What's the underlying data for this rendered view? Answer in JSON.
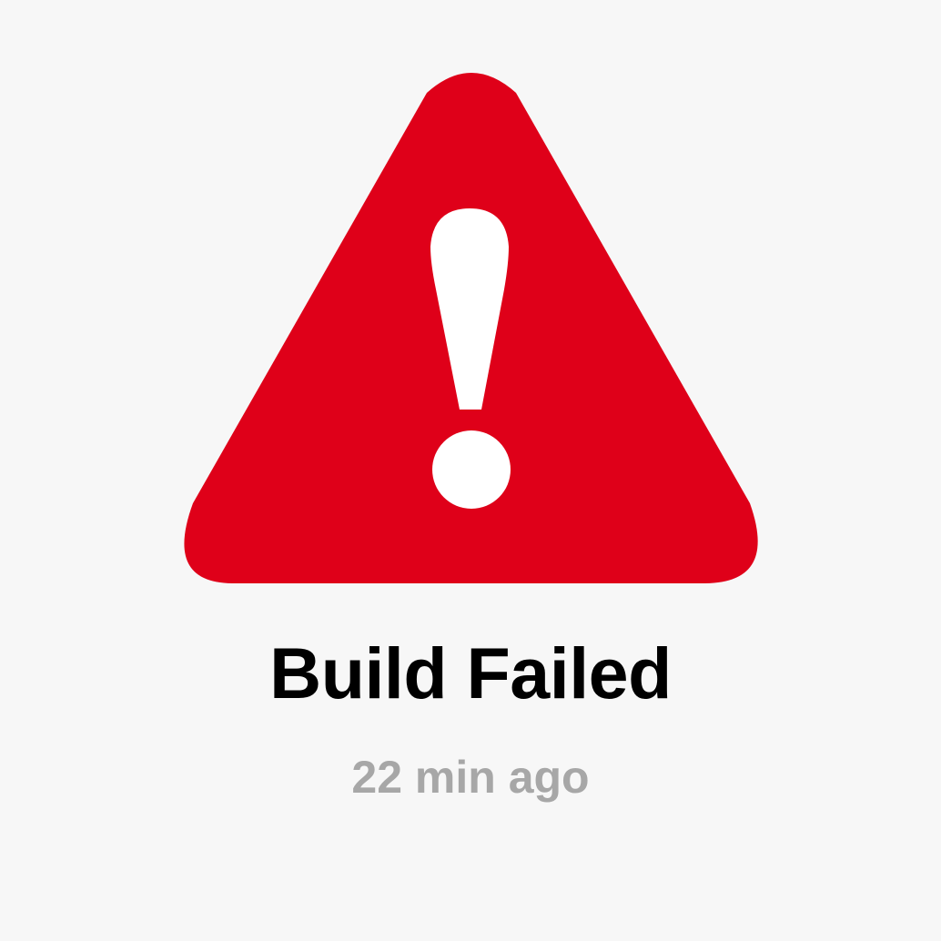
{
  "notification": {
    "icon": "warning-triangle-icon",
    "icon_color": "#df0019",
    "title": "Build Failed",
    "timestamp": "22 min ago",
    "title_color": "#000000",
    "timestamp_color": "#a7a7a7",
    "background_color": "#f7f7f7"
  }
}
